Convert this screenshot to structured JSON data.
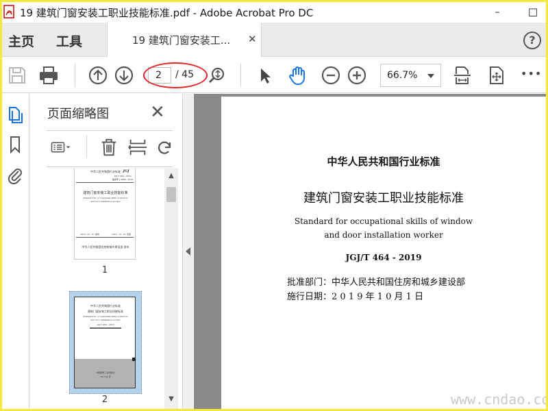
{
  "window": {
    "title": "19 建筑门窗安装工职业技能标准.pdf - Adobe Acrobat Pro DC",
    "minimize": "–",
    "maximize": "☐"
  },
  "tabs": {
    "home": "主页",
    "tools": "工具",
    "document_tab": "19 建筑门窗安装工...",
    "document_tab_close": "✕",
    "help": "?"
  },
  "toolbar": {
    "current_page": "2",
    "total_pages": "/ 45",
    "zoom": "66.7%",
    "more": "•••",
    "annotation_color": "#e32222"
  },
  "left_rail": {
    "icons": [
      "thumbnails-icon",
      "bookmark-icon",
      "attachment-icon"
    ],
    "active_color": "#1473e6"
  },
  "thumbnail_panel": {
    "title": "页面缩略图",
    "close": "✕",
    "thumbnails": [
      {
        "page_label": "1",
        "header_lines": [
          "中华人民共和国行业标准",
          "JGJ",
          "JGJ/T 464 - 2019",
          "备案号 J 2698 - 2019"
        ],
        "title": "建筑门窗安装工职业技能标准",
        "subtitle_lines": [
          "Standard for occupational skills of window",
          "and door installation worker"
        ],
        "date_left": "2019 - 02 - 01  发布",
        "date_right": "2019 - 10 - 01  实施",
        "footer": "中华人民共和国住房和城乡建设部  发布"
      },
      {
        "page_label": "2",
        "header_lines": [
          "中华人民共和国行业标准"
        ],
        "title": "建筑门窗安装工职业技能标准",
        "subtitle_lines": [
          "Standard for occupational skills of window",
          "and door installation worker"
        ],
        "code": "JGJ/T 464 - 2019",
        "footer_lines": [
          "中国建筑工业出版社",
          "2019  北  京"
        ]
      }
    ]
  },
  "document": {
    "heading": "中华人民共和国行业标准",
    "title": "建筑门窗安装工职业技能标准",
    "english_line1": "Standard for occupational skills of window",
    "english_line2": "and door installation worker",
    "code": "JGJ/T 464 - 2019",
    "approved_by": "批准部门：中华人民共和国住房和城乡建设部",
    "effective_date": "施行日期：2 0 1 9 年 1 0 月 1 日"
  },
  "watermark": "www.cndao.com"
}
